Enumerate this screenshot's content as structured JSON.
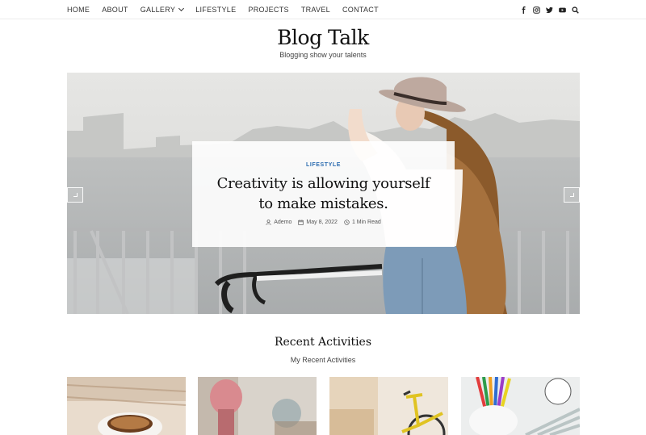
{
  "nav": {
    "items": [
      {
        "label": "HOME"
      },
      {
        "label": "ABOUT"
      },
      {
        "label": "GALLERY",
        "has_dropdown": true
      },
      {
        "label": "LIFESTYLE"
      },
      {
        "label": "PROJECTS"
      },
      {
        "label": "TRAVEL"
      },
      {
        "label": "CONTACT"
      }
    ],
    "social_icons": [
      "facebook-icon",
      "instagram-icon",
      "twitter-icon",
      "youtube-icon",
      "search-icon"
    ]
  },
  "site": {
    "title": "Blog Talk",
    "tagline": "Blogging show your talents"
  },
  "hero": {
    "category": "LIFESTYLE",
    "title": "Creativity is allowing yourself to make mistakes.",
    "author": "Ademo",
    "date": "May 8, 2022",
    "read_time": "1 Min Read",
    "prev_icon": "chevron-left-icon",
    "next_icon": "chevron-right-icon"
  },
  "recent": {
    "title": "Recent Activities",
    "subtitle": "My Recent Activities",
    "thumbnails": [
      "coffee-cup-photo",
      "blurred-figure-photo",
      "yellow-bicycle-photo",
      "pencil-cup-photo"
    ]
  },
  "colors": {
    "accent": "#2b6cb0",
    "text": "#111111",
    "nav_text": "#333333"
  }
}
